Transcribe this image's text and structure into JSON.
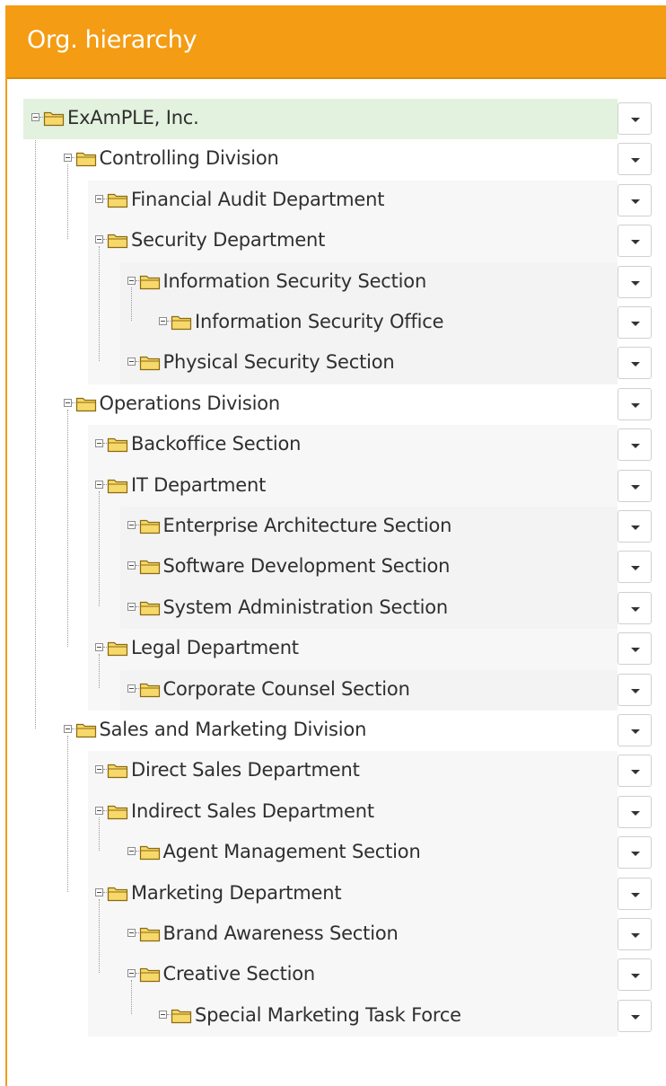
{
  "panel": {
    "title": "Org. hierarchy"
  },
  "colors": {
    "header": "#f49c14",
    "selected_row": "#e3f1df",
    "band_light": "#f7f7f7",
    "folder_fill": "#f7d86a",
    "folder_stroke": "#8a6a10"
  },
  "tree": {
    "nodes": [
      {
        "id": 0,
        "parent": -1,
        "depth": 0,
        "label": "ExAmPLE, Inc.",
        "selected": true
      },
      {
        "id": 1,
        "parent": 0,
        "depth": 1,
        "label": "Controlling Division"
      },
      {
        "id": 2,
        "parent": 1,
        "depth": 2,
        "label": "Financial Audit Department"
      },
      {
        "id": 3,
        "parent": 1,
        "depth": 2,
        "label": "Security Department"
      },
      {
        "id": 4,
        "parent": 3,
        "depth": 3,
        "label": "Information Security Section"
      },
      {
        "id": 5,
        "parent": 4,
        "depth": 4,
        "label": "Information Security Office"
      },
      {
        "id": 6,
        "parent": 3,
        "depth": 3,
        "label": "Physical Security Section"
      },
      {
        "id": 7,
        "parent": 0,
        "depth": 1,
        "label": "Operations Division"
      },
      {
        "id": 8,
        "parent": 7,
        "depth": 2,
        "label": "Backoffice Section"
      },
      {
        "id": 9,
        "parent": 7,
        "depth": 2,
        "label": "IT Department"
      },
      {
        "id": 10,
        "parent": 9,
        "depth": 3,
        "label": "Enterprise Architecture Section"
      },
      {
        "id": 11,
        "parent": 9,
        "depth": 3,
        "label": "Software Development Section"
      },
      {
        "id": 12,
        "parent": 9,
        "depth": 3,
        "label": "System Administration Section"
      },
      {
        "id": 13,
        "parent": 7,
        "depth": 2,
        "label": "Legal Department"
      },
      {
        "id": 14,
        "parent": 13,
        "depth": 3,
        "label": "Corporate Counsel Section"
      },
      {
        "id": 15,
        "parent": 0,
        "depth": 1,
        "label": "Sales and Marketing Division"
      },
      {
        "id": 16,
        "parent": 15,
        "depth": 2,
        "label": "Direct Sales Department"
      },
      {
        "id": 17,
        "parent": 15,
        "depth": 2,
        "label": "Indirect Sales Department"
      },
      {
        "id": 18,
        "parent": 17,
        "depth": 3,
        "label": "Agent Management Section"
      },
      {
        "id": 19,
        "parent": 15,
        "depth": 2,
        "label": "Marketing Department"
      },
      {
        "id": 20,
        "parent": 19,
        "depth": 3,
        "label": "Brand Awareness Section"
      },
      {
        "id": 21,
        "parent": 19,
        "depth": 3,
        "label": "Creative Section"
      },
      {
        "id": 22,
        "parent": 21,
        "depth": 4,
        "label": "Special Marketing Task Force"
      }
    ]
  }
}
